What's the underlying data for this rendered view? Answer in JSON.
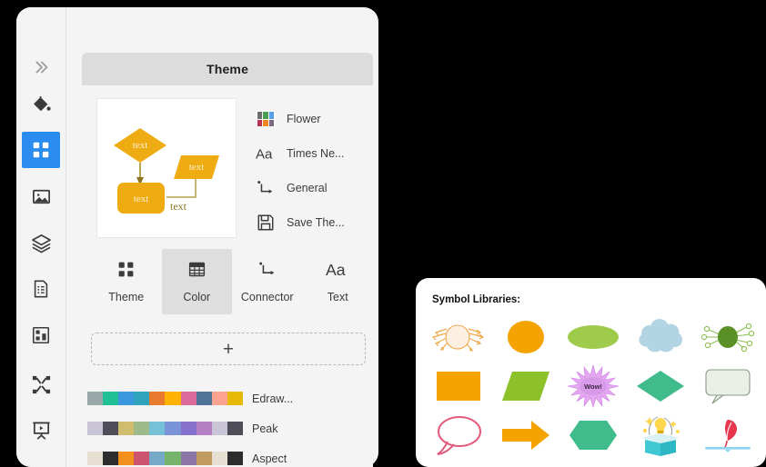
{
  "window": {
    "background_color": "#000000",
    "panel_color": "#f4f4f4"
  },
  "sidebar": {
    "items": [
      {
        "name": "expand-chevrons",
        "icon": "chevrons-right-icon",
        "active": false
      },
      {
        "name": "fill-color",
        "icon": "paint-bucket-icon",
        "active": false
      },
      {
        "name": "theme",
        "icon": "grid-squares-icon",
        "active": true
      },
      {
        "name": "image",
        "icon": "picture-icon",
        "active": false
      },
      {
        "name": "layers",
        "icon": "layers-icon",
        "active": false
      },
      {
        "name": "page-setup",
        "icon": "document-list-icon",
        "active": false
      },
      {
        "name": "chart",
        "icon": "chart-blocks-icon",
        "active": false
      },
      {
        "name": "arrange",
        "icon": "arrange-nodes-icon",
        "active": false
      },
      {
        "name": "present",
        "icon": "presentation-icon",
        "active": false
      }
    ]
  },
  "theme_panel": {
    "header_title": "Theme",
    "preview": {
      "shape_fill": "#eeab12",
      "connector_color": "#a78c25",
      "node_label": "text",
      "edge_label": "text",
      "nodes": [
        {
          "shape": "diamond",
          "label": "text"
        },
        {
          "shape": "rounded-rect",
          "label": "text"
        },
        {
          "shape": "parallelogram",
          "label": "text"
        }
      ]
    },
    "options": [
      {
        "label": "Flower",
        "icon": "color-swatch-grid-icon",
        "swatch_colors": [
          "#6d6d6d",
          "#4c9c52",
          "#5b9ee8",
          "#b73551",
          "#f0861f",
          "#7d6a84"
        ]
      },
      {
        "label": "Times Ne...",
        "icon": "font-aa-icon"
      },
      {
        "label": "General",
        "icon": "connector-elbow-icon"
      },
      {
        "label": "Save The...",
        "icon": "save-floppy-icon"
      }
    ],
    "tabs": [
      {
        "label": "Theme",
        "icon": "grid-squares-icon",
        "active": false
      },
      {
        "label": "Color",
        "icon": "color-table-icon",
        "active": true
      },
      {
        "label": "Connector",
        "icon": "connector-elbow-icon",
        "active": false
      },
      {
        "label": "Text",
        "icon": "font-aa-icon",
        "active": false
      }
    ],
    "add_button": {
      "label": "+",
      "icon": "plus-icon"
    },
    "palettes": [
      {
        "name": "Edraw...",
        "colors": [
          "#98a8a8",
          "#20bf96",
          "#3a96dd",
          "#2fa3bc",
          "#e87b2e",
          "#fdb300",
          "#d96a9a",
          "#4e7397",
          "#fba390",
          "#e5b905"
        ]
      },
      {
        "name": "Peak",
        "colors": [
          "#c9c4d6",
          "#4f4d57",
          "#cfbd6d",
          "#9dba8b",
          "#76c0d8",
          "#7a93d9",
          "#8571cc",
          "#b57fc4",
          "#c9c4d6",
          "#4f4d57"
        ]
      },
      {
        "name": "Aspect",
        "colors": [
          "#e6dfd2",
          "#2d2d2d",
          "#f4911e",
          "#cd546f",
          "#76a8c8",
          "#77b46b",
          "#8c76a8",
          "#c09a5e",
          "#e6dfd2",
          "#2d2d2d"
        ]
      }
    ]
  },
  "symbol_panel": {
    "title": "Symbol Libraries:",
    "symbols": [
      {
        "name": "circle-with-arrows",
        "shape": "circle-arrows",
        "fill": "#fdf0e3",
        "stroke": "#f0a94b"
      },
      {
        "name": "orange-circle",
        "shape": "circle",
        "fill": "#f5a300",
        "stroke": "#f5a300"
      },
      {
        "name": "green-ellipse",
        "shape": "ellipse",
        "fill": "#9ecb4c",
        "stroke": "#9ecb4c"
      },
      {
        "name": "blue-cloud",
        "shape": "cloud",
        "fill": "#b3d4e3",
        "stroke": "#b3d4e3"
      },
      {
        "name": "green-network-node",
        "shape": "network",
        "fill": "#5a9126",
        "stroke": "#7ab33c"
      },
      {
        "name": "orange-rectangle",
        "shape": "rect",
        "fill": "#f5a300",
        "stroke": "#f5a300"
      },
      {
        "name": "green-parallelogram",
        "shape": "parallelogram",
        "fill": "#8cc129",
        "stroke": "#8cc129"
      },
      {
        "name": "wow-starburst",
        "shape": "starburst",
        "fill": "#e3a8f0",
        "stroke": "#cf74e8",
        "label": "Wow!"
      },
      {
        "name": "teal-diamond",
        "shape": "diamond",
        "fill": "#3fbb8c",
        "stroke": "#3fbb8c"
      },
      {
        "name": "speech-box",
        "shape": "callout-box",
        "fill": "#eaefe7",
        "stroke": "#8a9b85"
      },
      {
        "name": "pink-speech-bubble",
        "shape": "speech-bubble",
        "fill": "#ffffff",
        "stroke": "#e35a7a"
      },
      {
        "name": "orange-arrow",
        "shape": "arrow",
        "fill": "#f5a300",
        "stroke": "#f5a300"
      },
      {
        "name": "green-hexagon",
        "shape": "hexagon",
        "fill": "#3fbb8c",
        "stroke": "#3fbb8c"
      },
      {
        "name": "idea-box",
        "shape": "idea-burst",
        "fill": "#2eb8c4",
        "stroke": "#ffd64d"
      },
      {
        "name": "red-balloon-pin",
        "shape": "balloon-pin",
        "fill": "#e8364f",
        "stroke": "#8cd3ef"
      }
    ]
  }
}
